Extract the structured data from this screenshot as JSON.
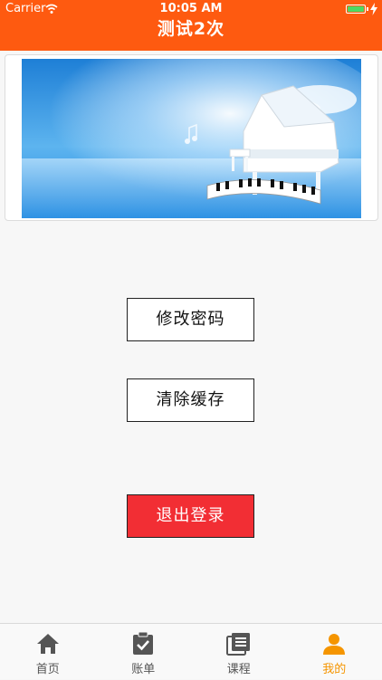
{
  "status": {
    "carrier": "Carrier",
    "time": "10:05 AM"
  },
  "header": {
    "title": "测试2次"
  },
  "banner": {
    "alt": "piano banner"
  },
  "actions": {
    "change_password": "修改密码",
    "clear_cache": "清除缓存",
    "logout": "退出登录"
  },
  "tabs": [
    {
      "label": "首页",
      "icon": "home-icon"
    },
    {
      "label": "账单",
      "icon": "clipboard-check-icon"
    },
    {
      "label": "课程",
      "icon": "course-list-icon"
    },
    {
      "label": "我的",
      "icon": "user-icon"
    }
  ],
  "colors": {
    "header": "#fe5a10",
    "logout": "#f22e34",
    "active_tab": "#f59500"
  }
}
